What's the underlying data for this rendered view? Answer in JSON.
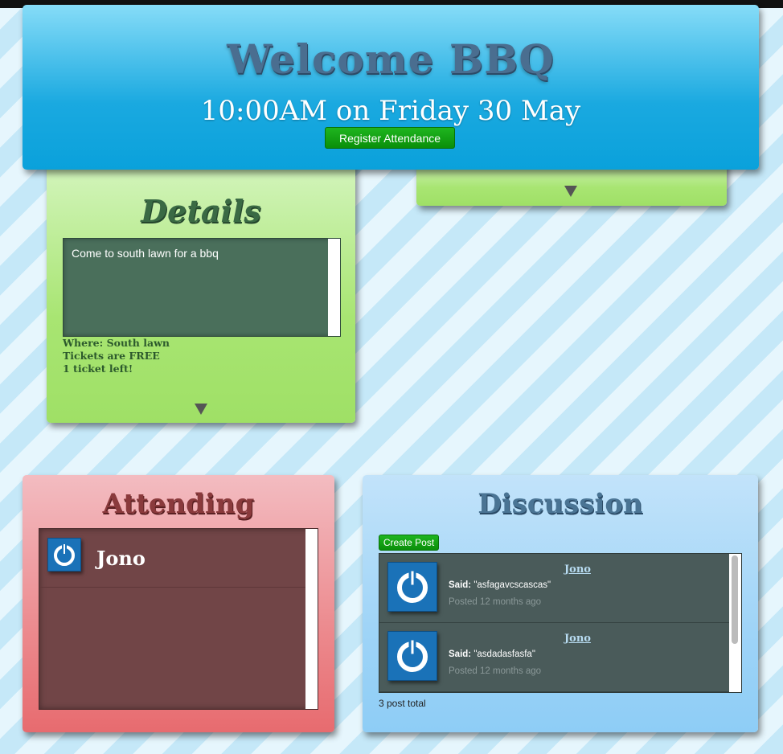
{
  "header": {
    "title": "Welcome BBQ",
    "subtitle": "10:00AM on Friday 30 May",
    "register_label": "Register Attendance"
  },
  "details": {
    "title": "Details",
    "description": "Come to south lawn for a bbq",
    "where": "Where: South lawn",
    "tickets": "Tickets are FREE",
    "remaining": "1 ticket left!"
  },
  "attending": {
    "title": "Attending",
    "people": [
      {
        "name": "Jono",
        "avatar_icon": "power-icon"
      }
    ]
  },
  "discussion": {
    "title": "Discussion",
    "create_label": "Create Post",
    "said_label": "Said:",
    "posts": [
      {
        "author": "Jono",
        "message": "\"asfagavcscascas\"",
        "time": "Posted 12 months ago",
        "avatar_icon": "power-icon"
      },
      {
        "author": "Jono",
        "message": "\"asdadasfasfa\"",
        "time": "Posted 12 months ago",
        "avatar_icon": "power-icon"
      }
    ],
    "total": "3 post total"
  },
  "colors": {
    "header": "#1aa9e0",
    "details": "#a8e572",
    "attending": "#ec8a8e",
    "discussion": "#9fd4f7",
    "button": "#0a8f0a"
  }
}
